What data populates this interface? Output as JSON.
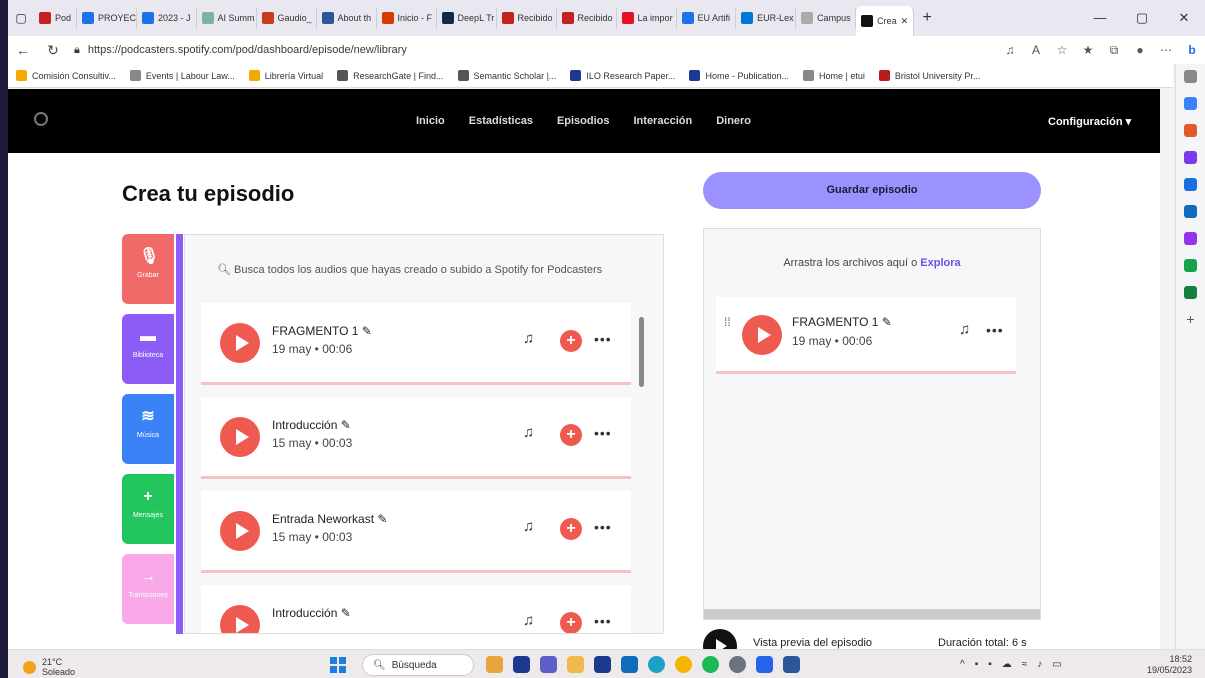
{
  "browser": {
    "tabs": [
      "Pod",
      "PROYECT",
      "2023 - J",
      "AI Summ",
      "Gaudio_",
      "About th",
      "Inicio - F",
      "DeepL Tr",
      "Recibido",
      "Recibido",
      "La impor",
      "EU Artifi",
      "EUR-Lex",
      "Campus",
      "Crea"
    ],
    "tab_colors": [
      "#c5221f",
      "#1a73e8",
      "#1a73e8",
      "#7fb3a0",
      "#c43e1c",
      "#2b579a",
      "#d83b01",
      "#0f2b46",
      "#c5221f",
      "#c5221f",
      "#e81123",
      "#1a73e8",
      "#0078d4",
      "#aaaaaa",
      "#111111"
    ],
    "url": "https://podcasters.spotify.com/pod/dashboard/episode/new/library",
    "bookmarks": [
      "Comisión Consultiv...",
      "Events | Labour Law...",
      "Librería Virtual",
      "ResearchGate | Find...",
      "Semantic Scholar |...",
      "ILO Research Paper...",
      "Home - Publication...",
      "Home | etui",
      "Bristol University Pr..."
    ]
  },
  "nav": {
    "links": [
      "Inicio",
      "Estadísticas",
      "Episodios",
      "Interacción",
      "Dinero"
    ],
    "settings": "Configuración ▾"
  },
  "page": {
    "title": "Crea tu episodio",
    "save": "Guardar episodio",
    "search_placeholder": "Busca todos los audios que hayas creado o subido a Spotify for Podcasters"
  },
  "tools": [
    {
      "label": "Grabar",
      "color": "#f06a6a",
      "icon": "microphone-icon"
    },
    {
      "label": "Biblioteca",
      "color": "#8b5cf6",
      "icon": "folder-icon"
    },
    {
      "label": "Música",
      "color": "#3b82f6",
      "icon": "music-icon"
    },
    {
      "label": "Mensajes",
      "color": "#22c55e",
      "icon": "message-icon"
    },
    {
      "label": "Transiciones",
      "color": "#f9a8e8",
      "icon": "arrow-icon"
    }
  ],
  "library": [
    {
      "name": "FRAGMENTO 1 ✎",
      "meta": "19 may • 00:06"
    },
    {
      "name": "Introducción ✎",
      "meta": "15 may • 00:03"
    },
    {
      "name": "Entrada Neworkast ✎",
      "meta": "15 may • 00:03"
    },
    {
      "name": "Introducción ✎",
      "meta": ""
    }
  ],
  "episode": {
    "drop_text": "Arrastra los archivos aquí o ",
    "drop_link": "Explora",
    "item": {
      "name": "FRAGMENTO 1 ✎",
      "meta": "19 may • 00:06"
    },
    "preview": "Vista previa del episodio",
    "duration": "Duración total: 6 s"
  },
  "taskbar": {
    "temp": "21°C",
    "weather": "Soleado",
    "search": "Búsqueda",
    "time": "18:52",
    "date": "19/05/2023"
  }
}
